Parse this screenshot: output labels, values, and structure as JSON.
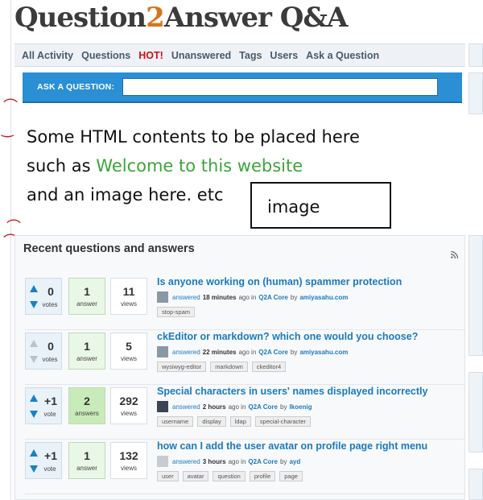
{
  "header": {
    "logo_question": "Question",
    "logo_two": "2",
    "logo_answer": "Answer",
    "logo_qa": "Q&A"
  },
  "nav": [
    {
      "label": "All Activity"
    },
    {
      "label": "Questions"
    },
    {
      "label": "HOT!"
    },
    {
      "label": "Unanswered"
    },
    {
      "label": "Tags"
    },
    {
      "label": "Users"
    },
    {
      "label": "Ask a Question"
    }
  ],
  "ask": {
    "label": "ASK A QUESTION:",
    "value": ""
  },
  "annotation": {
    "line1": "Some HTML contents to be placed here",
    "line2a": "such as ",
    "line2b": "Welcome to this website",
    "line3": "and an image here. etc",
    "image_label": "image"
  },
  "recent": {
    "heading": "Recent questions and answers",
    "questions": [
      {
        "votes": "0",
        "votes_label": "votes",
        "answers": "1",
        "answers_label": "answer",
        "views": "11",
        "views_label": "views",
        "title": "Is anyone working on (human) spammer protection",
        "action": "answered",
        "time": "18 minutes",
        "ago_in": "ago in",
        "category": "Q2A Core",
        "by": "by",
        "user": "amiyasahu.com",
        "tags": [
          "stop-spam"
        ]
      },
      {
        "votes": "0",
        "votes_label": "votes",
        "answers": "1",
        "answers_label": "answer",
        "views": "5",
        "views_label": "views",
        "title": "ckEditor or markdown? which one would you choose?",
        "action": "answered",
        "time": "22 minutes",
        "ago_in": "ago in",
        "category": "Q2A Core",
        "by": "by",
        "user": "amiyasahu.com",
        "tags": [
          "wysiwyg-editor",
          "markdown",
          "ckeditor4"
        ]
      },
      {
        "votes": "+1",
        "votes_label": "vote",
        "answers": "2",
        "answers_label": "answers",
        "views": "292",
        "views_label": "views",
        "title": "Special characters in users' names displayed incorrectly",
        "action": "answered",
        "time": "2 hours",
        "ago_in": "ago in",
        "category": "Q2A Core",
        "by": "by",
        "user": "lkoenig",
        "tags": [
          "username",
          "display",
          "ldap",
          "special-character"
        ]
      },
      {
        "votes": "+1",
        "votes_label": "vote",
        "answers": "1",
        "answers_label": "answer",
        "views": "132",
        "views_label": "views",
        "title": "how can I add the user avatar on profile page right menu",
        "action": "answered",
        "time": "3 hours",
        "ago_in": "ago in",
        "category": "Q2A Core",
        "by": "by",
        "user": "ayd",
        "tags": [
          "user",
          "avatar",
          "question",
          "profile",
          "page"
        ]
      }
    ]
  },
  "colors": {
    "accent": "#2a8fd4",
    "link": "#1a7bbf",
    "hot": "#cc1111",
    "green_text": "#3aa63a",
    "annotation_red": "#c8161d"
  }
}
